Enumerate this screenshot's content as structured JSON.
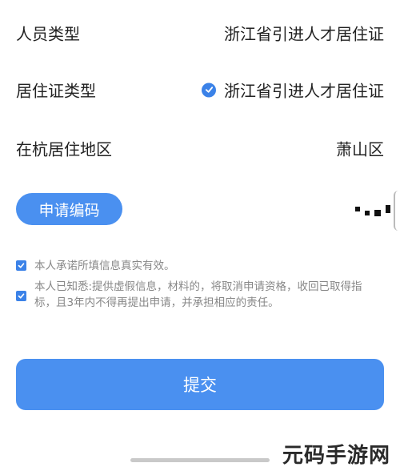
{
  "form": {
    "rows": [
      {
        "label": "人员类型",
        "value": "浙江省引进人才居住证"
      },
      {
        "label": "居住证类型",
        "value": "浙江省引进人才居住证",
        "selected": true
      },
      {
        "label": "在杭居住地区",
        "value": "萧山区"
      }
    ],
    "apply_code_label": "申请编码"
  },
  "consents": [
    {
      "text": "本人承诺所填信息真实有效。",
      "checked": true
    },
    {
      "text": "本人已知悉:提供虚假信息，材料的，将取消申请资格，收回已取得指标，且3年内不得再提出申请，并承担相应的责任。",
      "checked": true
    }
  ],
  "submit_label": "提交",
  "watermark": "元码手游网",
  "colors": {
    "accent": "#4a90f0",
    "check": "#3b82e8",
    "muted_text": "#888888"
  }
}
